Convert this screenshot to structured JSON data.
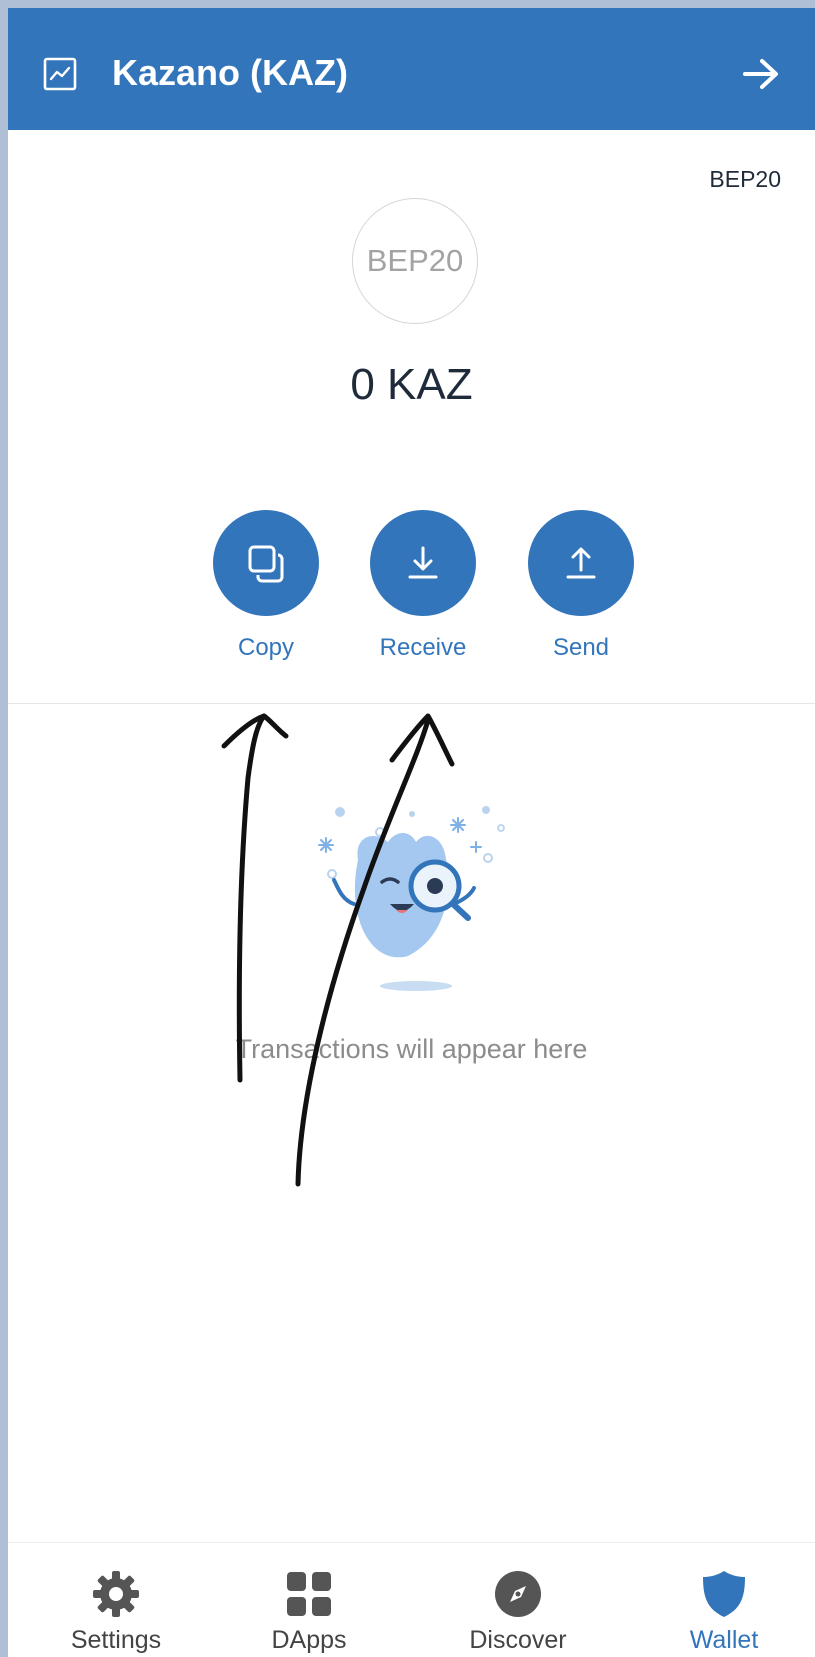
{
  "header": {
    "title": "Kazano (KAZ)",
    "chart_icon": "chart-icon",
    "forward_icon": "arrow-right-icon",
    "background": "#3375bb"
  },
  "token": {
    "network": "BEP20",
    "logo_text": "BEP20",
    "balance": "0 KAZ"
  },
  "actions": [
    {
      "label": "Copy",
      "icon": "copy-icon"
    },
    {
      "label": "Receive",
      "icon": "download-icon"
    },
    {
      "label": "Send",
      "icon": "upload-icon"
    }
  ],
  "empty_state": {
    "message": "Transactions will appear here",
    "illustration": "mascot-magnifier-illustration"
  },
  "nav": [
    {
      "label": "Settings",
      "icon": "gear-icon",
      "active": false
    },
    {
      "label": "DApps",
      "icon": "grid-icon",
      "active": false
    },
    {
      "label": "Discover",
      "icon": "compass-icon",
      "active": false
    },
    {
      "label": "Wallet",
      "icon": "shield-icon",
      "active": true
    }
  ],
  "colors": {
    "accent": "#3375bb",
    "text_dark": "#1f2a3a",
    "text_muted": "#8c8c8c",
    "nav_inactive": "#444444"
  }
}
